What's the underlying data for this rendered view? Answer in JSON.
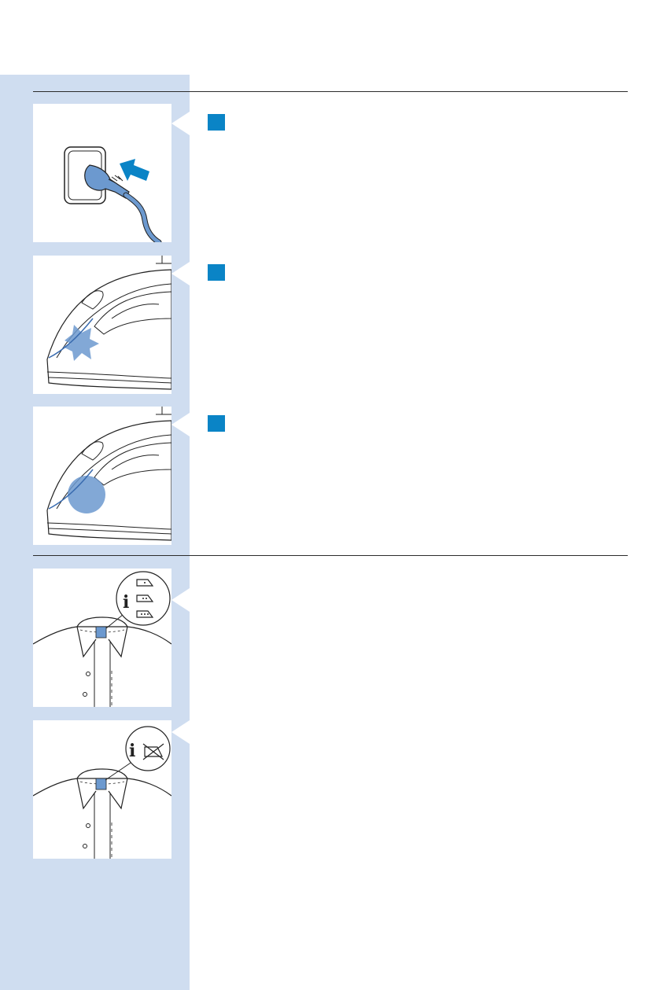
{
  "colors": {
    "sidebar": "#cfddf0",
    "accent_blue": "#0a84c6",
    "illustration_blue": "#6c99cf",
    "illustration_light_blue": "#a9c4e6",
    "rule": "#2b2b2b"
  },
  "sections": [
    {
      "steps": [
        {
          "illustration": "plug-into-wall-socket-icon",
          "marker": true
        },
        {
          "illustration": "iron-with-highlighted-area-icon",
          "marker": true
        },
        {
          "illustration": "iron-with-circled-area-icon",
          "marker": true
        }
      ]
    },
    {
      "steps": [
        {
          "illustration": "shirt-with-ironing-label-icon",
          "marker": false
        },
        {
          "illustration": "shirt-with-do-not-iron-label-icon",
          "marker": false
        }
      ]
    }
  ]
}
